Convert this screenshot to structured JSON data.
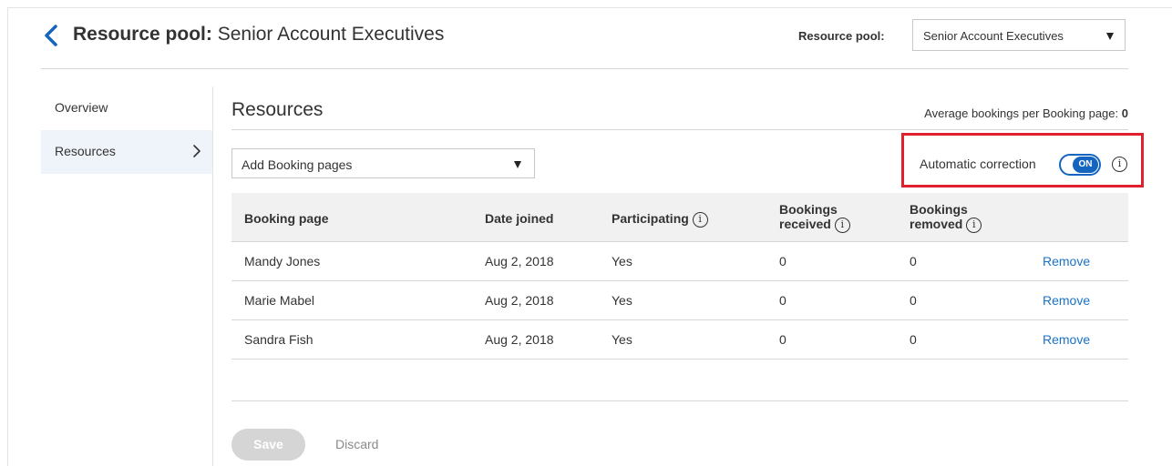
{
  "header": {
    "title_prefix": "Resource pool:",
    "title_name": "Senior Account Executives",
    "pool_label": "Resource pool:",
    "pool_selected": "Senior Account Executives"
  },
  "sidebar": {
    "items": [
      {
        "label": "Overview",
        "active": false
      },
      {
        "label": "Resources",
        "active": true
      }
    ]
  },
  "main": {
    "section_title": "Resources",
    "avg_label": "Average bookings per Booking page:",
    "avg_value": "0",
    "add_select_value": "Add Booking pages",
    "auto_correction_label": "Automatic correction",
    "toggle_text": "ON",
    "toggle_on": true
  },
  "table": {
    "headers": {
      "booking_page": "Booking page",
      "date_joined": "Date joined",
      "participating": "Participating",
      "bookings_received_1": "Bookings",
      "bookings_received_2": "received",
      "bookings_removed_1": "Bookings",
      "bookings_removed_2": "removed"
    },
    "rows": [
      {
        "name": "Mandy Jones",
        "date": "Aug 2, 2018",
        "participating": "Yes",
        "received": "0",
        "removed": "0",
        "action": "Remove"
      },
      {
        "name": "Marie Mabel",
        "date": "Aug 2, 2018",
        "participating": "Yes",
        "received": "0",
        "removed": "0",
        "action": "Remove"
      },
      {
        "name": "Sandra Fish",
        "date": "Aug 2, 2018",
        "participating": "Yes",
        "received": "0",
        "removed": "0",
        "action": "Remove"
      }
    ]
  },
  "footer": {
    "save_label": "Save",
    "discard_label": "Discard"
  },
  "info_glyph": "i",
  "colors": {
    "accent": "#1565c0",
    "link": "#1a73c8",
    "highlight": "#e0202e"
  }
}
